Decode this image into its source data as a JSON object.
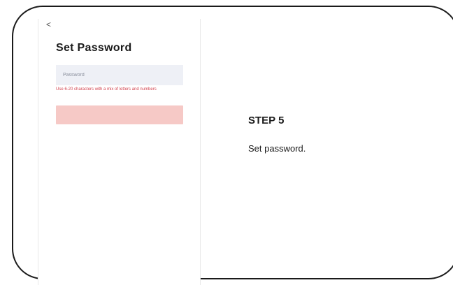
{
  "screen": {
    "back_glyph": "<",
    "back_icon": "chevron-left-icon",
    "title": "Set Password",
    "password_placeholder": "Password",
    "password_value": "",
    "hint": "Use 6-20 characters with a mix of letters and numbers",
    "submit_label": "",
    "submit_color": "#f6c9c6",
    "hint_color": "#d2424e"
  },
  "instructions": {
    "step": "STEP 5",
    "description": "Set password."
  }
}
